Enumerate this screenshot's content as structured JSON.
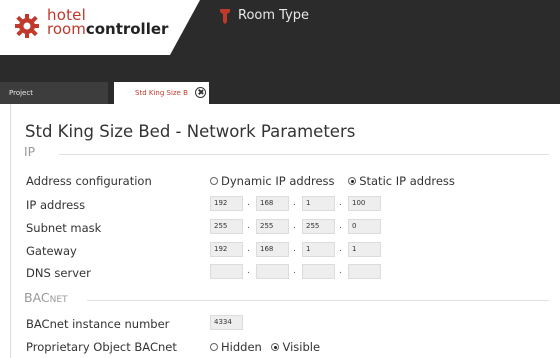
{
  "header": {
    "logo_line1": "hotel",
    "logo_line2_light": "room",
    "logo_line2_bold": "controller",
    "page_title": "Room Type"
  },
  "tabs": [
    {
      "label": "Project",
      "active": false
    },
    {
      "label": "Std King Size B",
      "active": true
    }
  ],
  "main": {
    "heading": "Std King Size Bed - Network Parameters",
    "ip_section": {
      "title": "IP",
      "address_configuration": {
        "label": "Address configuration",
        "options": [
          {
            "label": "Dynamic IP address",
            "checked": false
          },
          {
            "label": "Static IP address",
            "checked": true
          }
        ]
      },
      "ip_address": {
        "label": "IP address",
        "octets": [
          "192",
          "168",
          "1",
          "100"
        ]
      },
      "subnet_mask": {
        "label": "Subnet mask",
        "octets": [
          "255",
          "255",
          "255",
          "0"
        ]
      },
      "gateway": {
        "label": "Gateway",
        "octets": [
          "192",
          "168",
          "1",
          "1"
        ]
      },
      "dns_server": {
        "label": "DNS server",
        "octets": [
          "",
          "",
          "",
          ""
        ]
      }
    },
    "bacnet_section": {
      "title": "BACnet",
      "instance_number": {
        "label": "BACnet instance number",
        "value": "4334"
      },
      "proprietary_object": {
        "label": "Proprietary Object BACnet",
        "options": [
          {
            "label": "Hidden",
            "checked": false
          },
          {
            "label": "Visible",
            "checked": true
          }
        ]
      }
    }
  },
  "colors": {
    "accent": "#c0392b",
    "header_bg": "#2b2b2b",
    "field_bg": "#eeeeee"
  }
}
